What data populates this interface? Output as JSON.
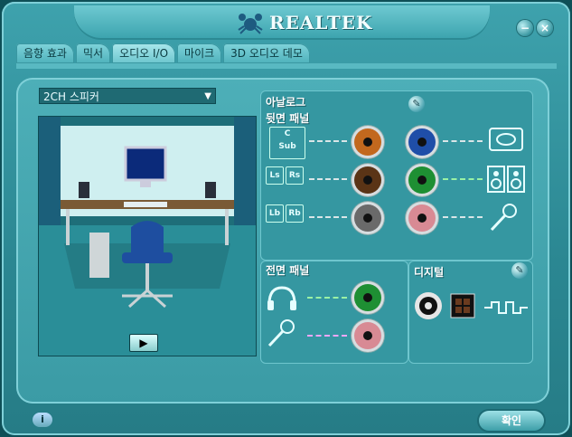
{
  "title": {
    "brand": "REALTEK"
  },
  "window": {
    "minimize_icon": "minus",
    "close_icon": "x"
  },
  "tabs": [
    {
      "label": "음향 효과"
    },
    {
      "label": "믹서"
    },
    {
      "label": "오디오 I/O"
    },
    {
      "label": "마이크"
    },
    {
      "label": "3D 오디오 데모"
    }
  ],
  "speaker_select": {
    "value": "2CH 스피커"
  },
  "analog": {
    "title": "아날로그",
    "rear_title": "뒷면 패널",
    "rear_labels": {
      "c": "C",
      "sub": "Sub",
      "ls": "Ls",
      "rs": "Rs",
      "lb": "Lb",
      "rb": "Rb"
    }
  },
  "front": {
    "title": "전면 패널"
  },
  "digital": {
    "title": "디지털"
  },
  "buttons": {
    "ok": "확인",
    "info": "i",
    "play": "▶",
    "help": "✎"
  },
  "jack_colors": {
    "orange": "#c2681e",
    "brown": "#5a3416",
    "gray": "#6a6a6a",
    "blue": "#1f4ea8",
    "green": "#1e8f33",
    "pink": "#d88a94"
  }
}
